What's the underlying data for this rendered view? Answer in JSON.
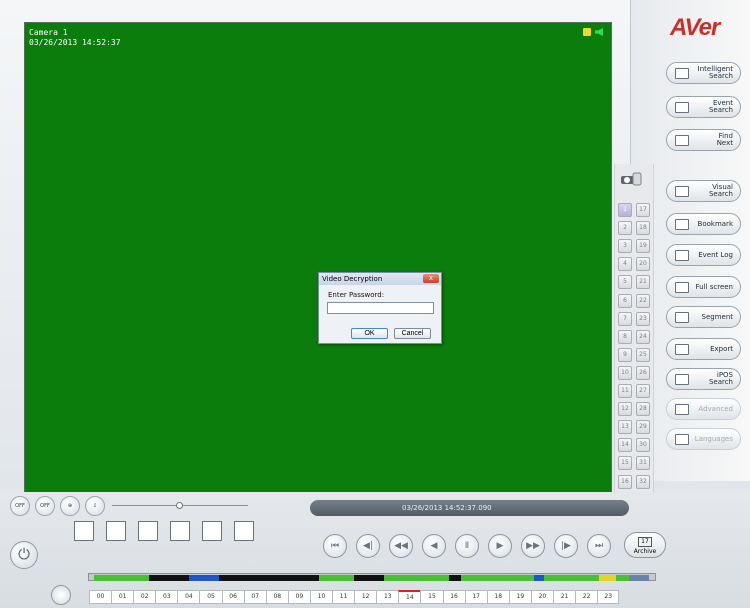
{
  "video": {
    "camera_name": "Camera 1",
    "camera_datetime": "03/26/2013 14:52:37"
  },
  "dialog": {
    "title": "Video Decryption",
    "close_label": "x",
    "label": "Enter Password:",
    "password_value": "",
    "ok_label": "OK",
    "cancel_label": "Cancel"
  },
  "logo": {
    "text": "AVer"
  },
  "side_buttons": [
    {
      "label": "Intelligent\nSearch",
      "icon": "intelligent-search-icon"
    },
    {
      "label": "Event\nSearch",
      "icon": "event-search-icon"
    },
    {
      "label": "Find\nNext",
      "icon": "find-next-icon"
    },
    {
      "label": "Visual\nSearch",
      "icon": "visual-search-icon"
    },
    {
      "label": "Bookmark",
      "icon": "bookmark-icon"
    },
    {
      "label": "Event Log",
      "icon": "event-log-icon"
    },
    {
      "label": "Full screen",
      "icon": "full-screen-icon"
    },
    {
      "label": "Segment",
      "icon": "segment-icon"
    },
    {
      "label": "Export",
      "icon": "export-icon"
    },
    {
      "label": "iPOS\nSearch",
      "icon": "ipos-search-icon"
    },
    {
      "label": "Advanced",
      "icon": "advanced-icon",
      "disabled": true
    },
    {
      "label": "Languages",
      "icon": "languages-icon",
      "disabled": true
    }
  ],
  "cameras": [
    "1",
    "17",
    "2",
    "18",
    "3",
    "19",
    "4",
    "20",
    "5",
    "21",
    "6",
    "22",
    "7",
    "23",
    "8",
    "24",
    "9",
    "25",
    "10",
    "26",
    "11",
    "27",
    "12",
    "28",
    "13",
    "29",
    "14",
    "30",
    "15",
    "31",
    "16",
    "32"
  ],
  "controls": {
    "timestamp": "03/26/2013 14:52:37.090",
    "archive_label": "Archive",
    "archive_day": "17"
  },
  "hours": [
    "00",
    "01",
    "02",
    "03",
    "04",
    "05",
    "06",
    "07",
    "08",
    "09",
    "10",
    "11",
    "12",
    "13",
    "14",
    "15",
    "16",
    "17",
    "18",
    "19",
    "20",
    "21",
    "22",
    "23"
  ],
  "colors": {
    "video_background": "#0b7d0c",
    "record_green": "#28c72e",
    "selected_hour": "#e11d1d"
  }
}
